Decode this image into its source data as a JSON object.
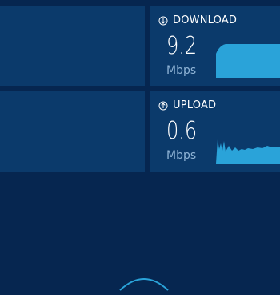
{
  "download": {
    "label": "DOWNLOAD",
    "value": "9.2",
    "unit": "Mbps"
  },
  "upload": {
    "label": "UPLOAD",
    "value": "0.6",
    "unit": "Mbps"
  },
  "colors": {
    "background": "#062650",
    "panel": "#0b3a6b",
    "accent": "#2aa3d9",
    "text": "#ffffff",
    "unit_text": "#8fb4d6"
  },
  "icons": {
    "download": "download-arrow-icon",
    "upload": "upload-arrow-icon"
  }
}
